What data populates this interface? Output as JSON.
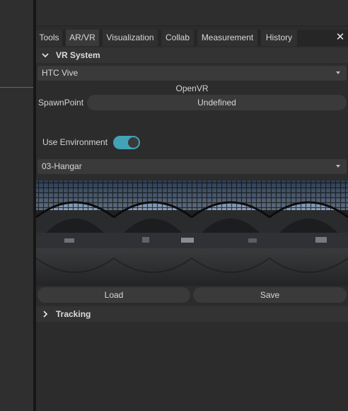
{
  "tabs": [
    {
      "label": "Tools",
      "active": false
    },
    {
      "label": "AR/VR",
      "active": true
    },
    {
      "label": "Visualization",
      "active": false
    },
    {
      "label": "Collab",
      "active": false
    },
    {
      "label": "Measurement",
      "active": false
    },
    {
      "label": "History",
      "active": false
    }
  ],
  "close_label": "✕",
  "vr_system": {
    "title": "VR System",
    "expanded": true,
    "device_selected": "HTC Vive",
    "runtime": "OpenVR",
    "spawnpoint_label": "SpawnPoint",
    "spawnpoint_value": "Undefined",
    "use_environment_label": "Use Environment",
    "use_environment_on": true,
    "environment_selected": "03-Hangar",
    "load_label": "Load",
    "save_label": "Save"
  },
  "tracking": {
    "title": "Tracking",
    "expanded": false
  },
  "colors": {
    "toggle_accent": "#42a3b5",
    "guide_line": "#b8473f"
  }
}
